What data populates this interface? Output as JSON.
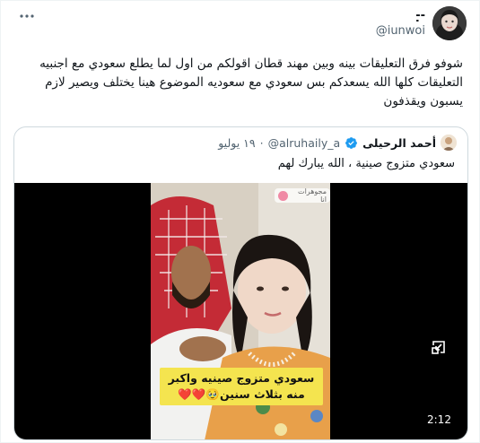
{
  "tweet": {
    "author": {
      "display_name": "-̣̣-",
      "handle": "@iunwoi"
    },
    "text": "شوفو فرق التعليقات بينه وبين مهند قطان اقولكم من اول لما يطلع سعودي مع اجنبيه التعليقات كلها الله يسعدكم بس سعودي مع سعوديه الموضوع هينا يختلف ويصير لازم يسبون ويقذفون",
    "more_icon": "ellipsis-icon"
  },
  "quoted_tweet": {
    "author": {
      "display_name": "أحمد الرحيلى",
      "handle": "@alruhaily_a",
      "verified_icon": "verified-badge-icon"
    },
    "separator": "·",
    "date": "١٩ يوليو",
    "text": "سعودي متزوج صينية ، الله يبارك لهم",
    "video": {
      "caption": "سعودي متزوج صينيه واكبر منه بثلاث سنين🥹❤️❤️",
      "watermark": "مجوهرات انا",
      "duration": "2:12",
      "expand_icon": "collapse-arrow-icon"
    }
  },
  "colors": {
    "text_primary": "#0f1419",
    "text_secondary": "#536471",
    "verified_blue": "#1d9bf0",
    "caption_yellow": "#f4e44f",
    "border": "#cfd9de"
  }
}
